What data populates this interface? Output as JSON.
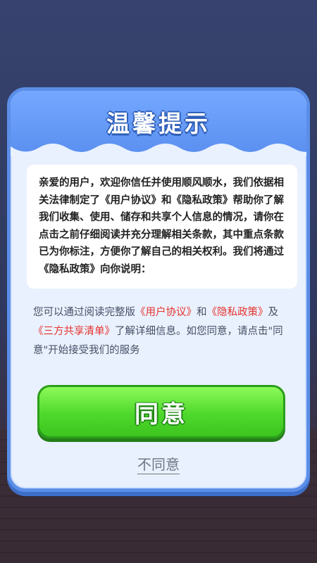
{
  "dialog": {
    "title": "温馨提示",
    "terms_text": "亲爱的用户，欢迎你信任并使用顺风顺水，我们依据相关法律制定了《用户协议》和《隐私政策》帮助你了解我们收集、使用、储存和共享个人信息的情况，请你在点击之前仔细阅读并充分理解相关条款，其中重点条款已为你标注，方便你了解自己的相关权利。我们将通过《隐私政策》向你说明：",
    "info": {
      "prefix": "您可以通过阅读完整版",
      "user_agreement_link": "《用户协议》",
      "and_text": "和",
      "privacy_policy_link": "《隐私政策》",
      "and_text_2": "及",
      "third_party_list_link": "《三方共享清单》",
      "suffix": "了解详细信息。如您同意，请点击\"同意\"开始接受我们的服务"
    },
    "agree_label": "同意",
    "disagree_label": "不同意"
  },
  "colors": {
    "accent_blue": "#5b8ee8",
    "agree_green": "#4fd82c",
    "link_red": "#e5322d"
  }
}
